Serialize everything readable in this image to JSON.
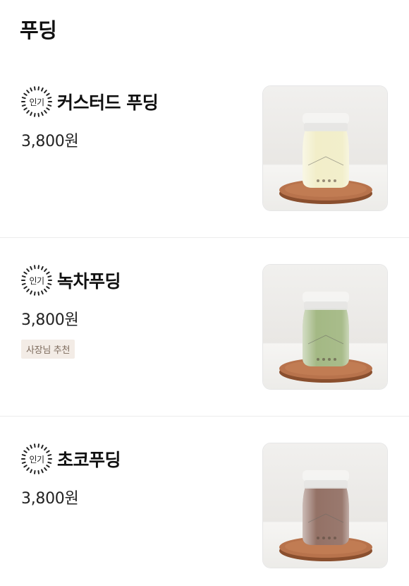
{
  "category": {
    "title": "푸딩"
  },
  "items": [
    {
      "badge": "인기",
      "name": "커스터드 푸딩",
      "price": "3,800원",
      "tag": "",
      "image_icon": "custard-pudding-jar",
      "pudding_color": "#f1edc6"
    },
    {
      "badge": "인기",
      "name": "녹차푸딩",
      "price": "3,800원",
      "tag": "사장님 추천",
      "image_icon": "green-tea-pudding-jar",
      "pudding_color": "#9fb57e"
    },
    {
      "badge": "인기",
      "name": "초코푸딩",
      "price": "3,800원",
      "tag": "",
      "image_icon": "chocolate-pudding-jar",
      "pudding_color": "#8e6a5e"
    }
  ]
}
